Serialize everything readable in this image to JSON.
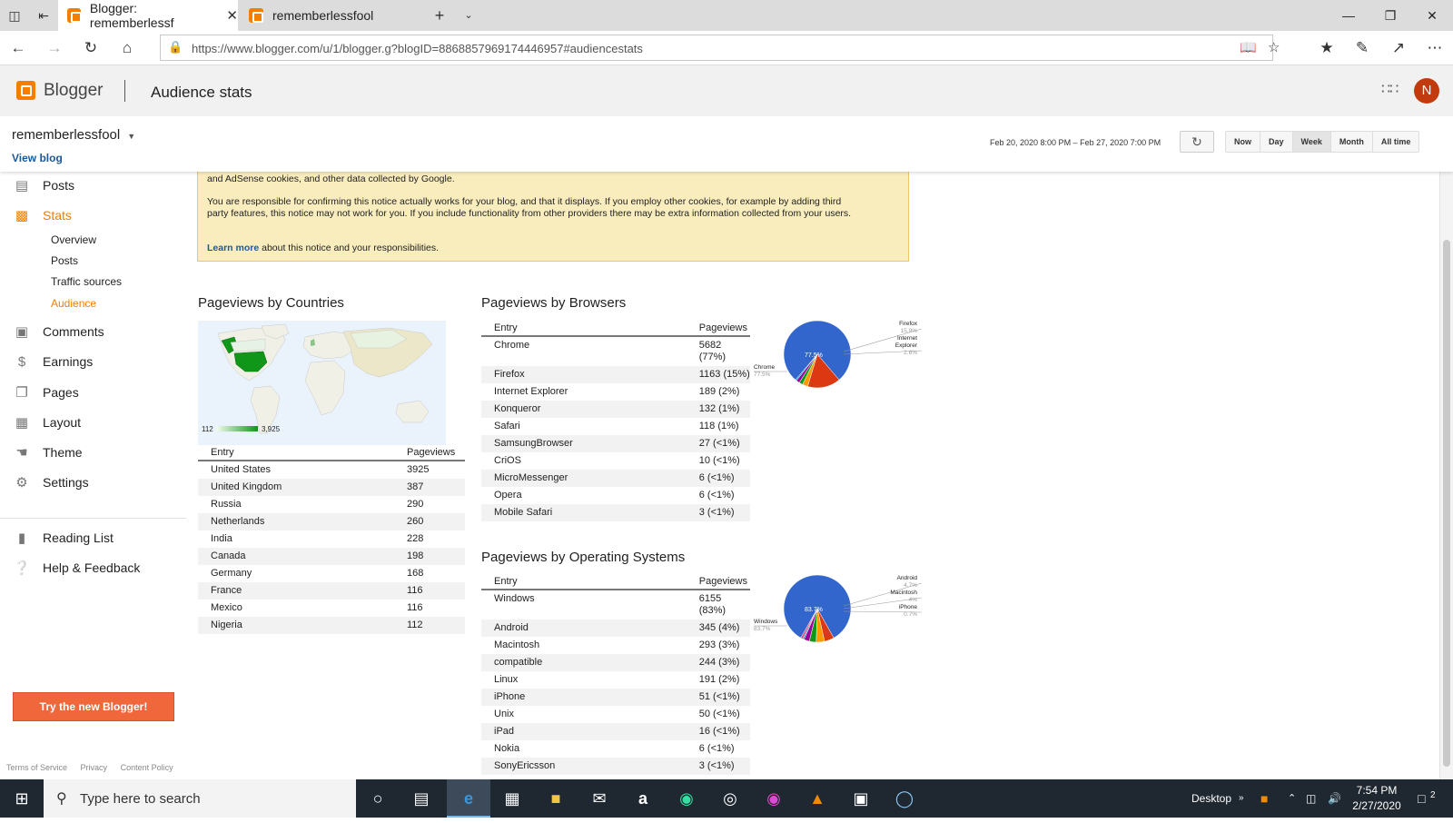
{
  "browser": {
    "tabs": [
      {
        "title": "Blogger: rememberlessf"
      },
      {
        "title": "rememberlessfool"
      }
    ],
    "url": "https://www.blogger.com/u/1/blogger.g?blogID=8868857969174446957#audiencestats",
    "icons": [
      "tab-list-icon",
      "back-tab-icon",
      "new-tab-icon",
      "chevron-down-icon",
      "minimize-icon",
      "restore-icon",
      "close-icon",
      "back-icon",
      "forward-icon",
      "refresh-icon",
      "home-icon",
      "lock-icon",
      "reading-view-icon",
      "favorite-star-icon",
      "favorites-icon",
      "pen-icon",
      "share-icon",
      "more-icon"
    ]
  },
  "header": {
    "app_name": "Blogger",
    "page_title": "Audience stats",
    "avatar_letter": "N",
    "brand_color": "#f57d00"
  },
  "subheader": {
    "blog_name": "rememberlessfool",
    "view_blog": "View blog",
    "date_range": "Feb 20, 2020 8:00 PM – Feb 27, 2020 7:00 PM",
    "range_buttons": [
      "Now",
      "Day",
      "Week",
      "Month",
      "All time"
    ],
    "selected_range": "Week"
  },
  "sidebar": {
    "items": [
      {
        "label": "Posts",
        "icon": "posts-icon"
      },
      {
        "label": "Stats",
        "icon": "stats-icon"
      },
      {
        "label": "Comments",
        "icon": "comments-icon"
      },
      {
        "label": "Earnings",
        "icon": "dollar-icon"
      },
      {
        "label": "Pages",
        "icon": "pages-icon"
      },
      {
        "label": "Layout",
        "icon": "layout-icon"
      },
      {
        "label": "Theme",
        "icon": "theme-icon"
      },
      {
        "label": "Settings",
        "icon": "gear-icon"
      },
      {
        "label": "Reading List",
        "icon": "bookmark-icon"
      },
      {
        "label": "Help & Feedback",
        "icon": "help-icon"
      }
    ],
    "stats_subitems": [
      "Overview",
      "Posts",
      "Traffic sources",
      "Audience"
    ],
    "try_button": "Try the new Blogger!",
    "footer_links": [
      "Terms of Service",
      "Privacy",
      "Content Policy"
    ]
  },
  "notice": {
    "line1": "and AdSense cookies, and other data collected by Google.",
    "line2": "You are responsible for confirming this notice actually works for your blog, and that it displays. If you employ other cookies, for example by adding third party features, this notice may not work for you. If you include functionality from other providers there may be extra information collected from your users.",
    "learn_more": "Learn more",
    "line3": "about this notice and your responsibilities."
  },
  "countries": {
    "title": "Pageviews by Countries",
    "legend_min": "112",
    "legend_max": "3,925",
    "headers": {
      "entry": "Entry",
      "pageviews": "Pageviews"
    },
    "rows": [
      {
        "entry": "United States",
        "pageviews": "3925"
      },
      {
        "entry": "United Kingdom",
        "pageviews": "387"
      },
      {
        "entry": "Russia",
        "pageviews": "290"
      },
      {
        "entry": "Netherlands",
        "pageviews": "260"
      },
      {
        "entry": "India",
        "pageviews": "228"
      },
      {
        "entry": "Canada",
        "pageviews": "198"
      },
      {
        "entry": "Germany",
        "pageviews": "168"
      },
      {
        "entry": "France",
        "pageviews": "116"
      },
      {
        "entry": "Mexico",
        "pageviews": "116"
      },
      {
        "entry": "Nigeria",
        "pageviews": "112"
      }
    ]
  },
  "browsers": {
    "title": "Pageviews by Browsers",
    "headers": {
      "entry": "Entry",
      "pageviews": "Pageviews"
    },
    "rows": [
      {
        "entry": "Chrome",
        "pageviews": "5682 (77%)"
      },
      {
        "entry": "Firefox",
        "pageviews": "1163 (15%)"
      },
      {
        "entry": "Internet Explorer",
        "pageviews": "189 (2%)"
      },
      {
        "entry": "Konqueror",
        "pageviews": "132 (1%)"
      },
      {
        "entry": "Safari",
        "pageviews": "118 (1%)"
      },
      {
        "entry": "SamsungBrowser",
        "pageviews": "27 (<1%)"
      },
      {
        "entry": "CriOS",
        "pageviews": "10 (<1%)"
      },
      {
        "entry": "MicroMessenger",
        "pageviews": "6 (<1%)"
      },
      {
        "entry": "Opera",
        "pageviews": "6 (<1%)"
      },
      {
        "entry": "Mobile Safari",
        "pageviews": "3 (<1%)"
      }
    ]
  },
  "os": {
    "title": "Pageviews by Operating Systems",
    "headers": {
      "entry": "Entry",
      "pageviews": "Pageviews"
    },
    "rows": [
      {
        "entry": "Windows",
        "pageviews": "6155 (83%)"
      },
      {
        "entry": "Android",
        "pageviews": "345 (4%)"
      },
      {
        "entry": "Macintosh",
        "pageviews": "293 (3%)"
      },
      {
        "entry": "compatible",
        "pageviews": "244 (3%)"
      },
      {
        "entry": "Linux",
        "pageviews": "191 (2%)"
      },
      {
        "entry": "iPhone",
        "pageviews": "51 (<1%)"
      },
      {
        "entry": "Unix",
        "pageviews": "50 (<1%)"
      },
      {
        "entry": "iPad",
        "pageviews": "16 (<1%)"
      },
      {
        "entry": "Nokia",
        "pageviews": "6 (<1%)"
      },
      {
        "entry": "SonyEricsson",
        "pageviews": "3 (<1%)"
      }
    ]
  },
  "chart_data": [
    {
      "type": "pie",
      "categories": [
        "Chrome",
        "Firefox",
        "Internet Explorer",
        "Konqueror",
        "Safari",
        "Other"
      ],
      "values": [
        77.5,
        15.9,
        2.6,
        1.8,
        1.6,
        0.6
      ],
      "colors": [
        "#3366cc",
        "#dc3912",
        "#ff9900",
        "#109618",
        "#990099",
        "#0099c6"
      ],
      "center_label": "77.5%",
      "callouts": [
        {
          "name": "Chrome",
          "pct": "77.5%"
        },
        {
          "name": "Firefox",
          "pct": "15.9%"
        },
        {
          "name": "Internet Explorer",
          "pct": "2.6%"
        }
      ]
    },
    {
      "type": "pie",
      "categories": [
        "Windows",
        "Android",
        "Macintosh",
        "compatible",
        "Linux",
        "iPhone",
        "Other"
      ],
      "values": [
        83.7,
        4.7,
        4.0,
        3.3,
        2.6,
        0.7,
        1.0
      ],
      "colors": [
        "#3366cc",
        "#dc3912",
        "#ff9900",
        "#109618",
        "#990099",
        "#0099c6",
        "#dd4477"
      ],
      "center_label": "83.7%",
      "callouts": [
        {
          "name": "Windows",
          "pct": "83.7%"
        },
        {
          "name": "Android",
          "pct": "4.7%"
        },
        {
          "name": "Macintosh",
          "pct": "4%"
        },
        {
          "name": "iPhone",
          "pct": "0.7%"
        }
      ]
    }
  ],
  "taskbar": {
    "search_placeholder": "Type here to search",
    "desktop_label": "Desktop",
    "time": "7:54 PM",
    "date": "2/27/2020",
    "notification_count": "2",
    "pinned_icons": [
      "task-view-icon",
      "timeline-icon",
      "edge-icon",
      "store-icon",
      "file-explorer-icon",
      "mail-icon",
      "amazon-icon",
      "tripadvisor-icon",
      "camera-app-icon",
      "paint-icon",
      "vlc-icon",
      "screenshot-icon",
      "paint3d-icon"
    ]
  }
}
